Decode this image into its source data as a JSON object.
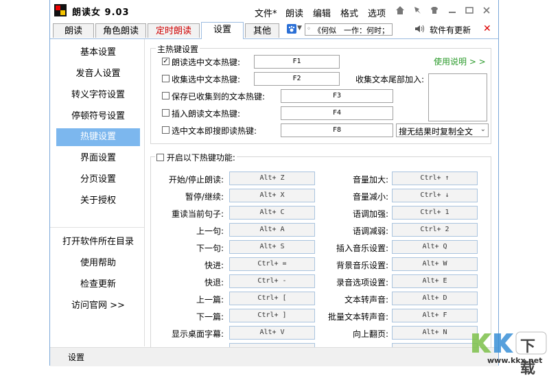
{
  "window": {
    "title": "朗读女 9.03",
    "menu": [
      "文件*",
      "朗读",
      "编辑",
      "格式",
      "选项"
    ],
    "controls": [
      "home-icon",
      "pin-icon",
      "skin-icon",
      "minimize-icon",
      "maximize-icon",
      "close-icon"
    ]
  },
  "tabs": [
    "朗读",
    "角色朗读",
    "定时朗读",
    "设置",
    "其他"
  ],
  "active_tab": "设置",
  "timed_tab_color": "#d00000",
  "toolbar": {
    "search_value": "《何似　一作：何时；",
    "update_label": "软件有更新",
    "close_glyph": "✕"
  },
  "sidebar": {
    "items": [
      "基本设置",
      "发音人设置",
      "转义字符设置",
      "停顿符号设置",
      "热键设置",
      "界面设置",
      "分页设置",
      "关于授权"
    ],
    "selected": "热键设置",
    "bottom_items": [
      "打开软件所在目录",
      "使用帮助",
      "检查更新",
      "访问官网 >>"
    ]
  },
  "main_hotkeys": {
    "group_label": "主热键设置",
    "help_link": "使用说明 > >",
    "rows": [
      {
        "label": "朗读选中文本热键:",
        "checked": true,
        "key": "F1"
      },
      {
        "label": "收集选中文本热键:",
        "checked": false,
        "key": "F2"
      },
      {
        "label": "保存已收集到的文本热键:",
        "checked": false,
        "key": "F3"
      },
      {
        "label": "插入朗读文本热键:",
        "checked": false,
        "key": "F4"
      },
      {
        "label": "选中文本即搜即读热键:",
        "checked": false,
        "key": "F8"
      }
    ],
    "collect_tail_label": "收集文本尾部加入:",
    "search_select_value": "搜无结果时复制全文"
  },
  "hotkey_functions": {
    "enable_label": "开启以下热键功能:",
    "left": [
      {
        "label": "开始/停止朗读:",
        "key": "Alt+ Z"
      },
      {
        "label": "暂停/继续:",
        "key": "Alt+ X"
      },
      {
        "label": "重读当前句子:",
        "key": "Alt+ C"
      },
      {
        "label": "上一句:",
        "key": "Alt+ A"
      },
      {
        "label": "下一句:",
        "key": "Alt+ S"
      },
      {
        "label": "快进:",
        "key": "Ctrl+ ="
      },
      {
        "label": "快退:",
        "key": "Ctrl+ -"
      },
      {
        "label": "上一篇:",
        "key": "Ctrl+ ["
      },
      {
        "label": "下一篇:",
        "key": "Ctrl+ ]"
      },
      {
        "label": "显示桌面字幕:",
        "key": "Alt+ V"
      }
    ],
    "right": [
      {
        "label": "音量加大:",
        "key": "Ctrl+ ↑"
      },
      {
        "label": "音量减小:",
        "key": "Ctrl+ ↓"
      },
      {
        "label": "语调加强:",
        "key": "Ctrl+ 1"
      },
      {
        "label": "语调减弱:",
        "key": "Ctrl+ 2"
      },
      {
        "label": "插入音乐设置:",
        "key": "Alt+ Q"
      },
      {
        "label": "背景音乐设置:",
        "key": "Alt+ W"
      },
      {
        "label": "录音选项设置:",
        "key": "Alt+ E"
      },
      {
        "label": "文本转声音:",
        "key": "Alt+ D"
      },
      {
        "label": "批量文本转声音:",
        "key": "Alt+ F"
      },
      {
        "label": "向上翻页:",
        "key": "Alt+ N"
      }
    ]
  },
  "statusbar": {
    "text": "设置"
  },
  "watermark": {
    "brand": "KK下载",
    "url": "www.kkx.net"
  }
}
